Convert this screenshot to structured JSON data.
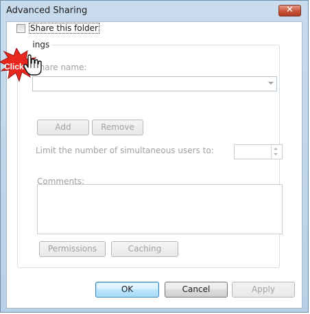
{
  "window": {
    "title": "Advanced Sharing",
    "close_label": "✕"
  },
  "share": {
    "checkbox_label": "Share this folder",
    "checked": false
  },
  "settings": {
    "group_label": "Settings",
    "group_label_visible": "ings",
    "share_name_label": "Share name:",
    "add_label": "Add",
    "remove_label": "Remove",
    "limit_label": "Limit the number of simultaneous users to:",
    "comments_label": "Comments:",
    "permissions_label": "Permissions",
    "caching_label": "Caching"
  },
  "footer": {
    "ok_label": "OK",
    "cancel_label": "Cancel",
    "apply_label": "Apply"
  },
  "annotation": {
    "text": "Click",
    "icon": "hand-pointer-icon",
    "color": "#e8281e"
  }
}
